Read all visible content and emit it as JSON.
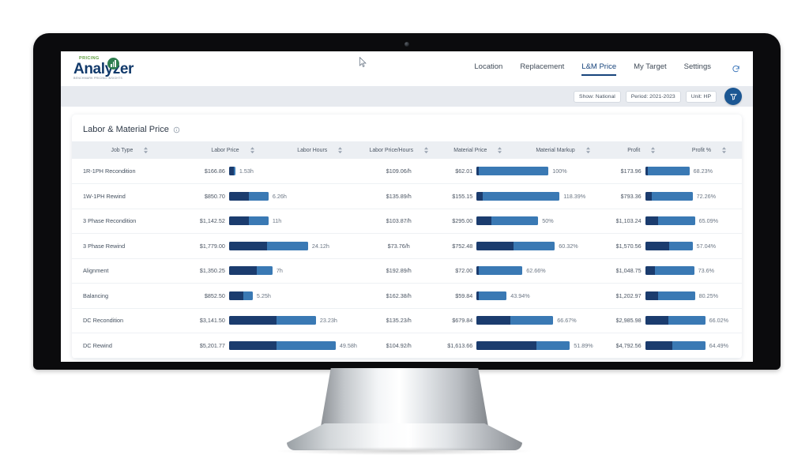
{
  "brand": {
    "kicker": "PRICING",
    "name": "Analyzer",
    "tagline": "BENCHMARK PRICING INSIGHTS",
    "chart_badge_icon": "bar-chart-icon"
  },
  "nav": {
    "items": [
      {
        "label": "Location",
        "active": false
      },
      {
        "label": "Replacement",
        "active": false
      },
      {
        "label": "L&M Price",
        "active": true
      },
      {
        "label": "My Target",
        "active": false
      },
      {
        "label": "Settings",
        "active": false
      }
    ],
    "refresh_icon": "refresh-icon"
  },
  "filters": {
    "chips": [
      {
        "label": "Show: National"
      },
      {
        "label": "Period: 2021-2023"
      },
      {
        "label": "Unit: HP"
      }
    ],
    "funnel_icon": "funnel-icon",
    "funnel_color": "#1c5793"
  },
  "card": {
    "title": "Labor & Material Price",
    "info_icon": "info-circle-icon"
  },
  "colors": {
    "bar_dark": "#1b3c6e",
    "bar_light": "#3a79b4",
    "accent": "#17447c",
    "header_bg": "#eceff3",
    "filter_bar_bg": "#e7eaef"
  },
  "table": {
    "columns": [
      {
        "label": "Job Type",
        "sortable": true
      },
      {
        "label": "Labor Price",
        "sortable": true
      },
      {
        "label": "Labor Hours",
        "sortable": true
      },
      {
        "label": "Labor Price/Hours",
        "sortable": true
      },
      {
        "label": "Material Price",
        "sortable": true
      },
      {
        "label": "Material Markup",
        "sortable": true
      },
      {
        "label": "Profit",
        "sortable": true
      },
      {
        "label": "Profit %",
        "sortable": true
      }
    ],
    "rows": [
      {
        "job_type": "1R-1PH Recondition",
        "labor_price": "$166.86",
        "labor_hours": "1.53h",
        "labor_price_per_hour": "$109.06/h",
        "material_price": "$62.01",
        "material_markup": "100%",
        "profit": "$173.96",
        "profit_pct": "68.23%"
      },
      {
        "job_type": "1W-1PH Rewind",
        "labor_price": "$850.70",
        "labor_hours": "6.26h",
        "labor_price_per_hour": "$135.89/h",
        "material_price": "$155.15",
        "material_markup": "118.39%",
        "profit": "$793.36",
        "profit_pct": "72.26%"
      },
      {
        "job_type": "3 Phase Recondition",
        "labor_price": "$1,142.52",
        "labor_hours": "11h",
        "labor_price_per_hour": "$103.87/h",
        "material_price": "$295.00",
        "material_markup": "50%",
        "profit": "$1,103.24",
        "profit_pct": "65.09%"
      },
      {
        "job_type": "3 Phase Rewind",
        "labor_price": "$1,779.00",
        "labor_hours": "24.12h",
        "labor_price_per_hour": "$73.76/h",
        "material_price": "$752.48",
        "material_markup": "60.32%",
        "profit": "$1,570.56",
        "profit_pct": "57.04%"
      },
      {
        "job_type": "Alignment",
        "labor_price": "$1,350.25",
        "labor_hours": "7h",
        "labor_price_per_hour": "$192.89/h",
        "material_price": "$72.00",
        "material_markup": "62.66%",
        "profit": "$1,048.75",
        "profit_pct": "73.6%"
      },
      {
        "job_type": "Balancing",
        "labor_price": "$852.50",
        "labor_hours": "5.25h",
        "labor_price_per_hour": "$162.38/h",
        "material_price": "$59.84",
        "material_markup": "43.94%",
        "profit": "$1,202.97",
        "profit_pct": "80.25%"
      },
      {
        "job_type": "DC Recondition",
        "labor_price": "$3,141.50",
        "labor_hours": "23.23h",
        "labor_price_per_hour": "$135.23/h",
        "material_price": "$679.84",
        "material_markup": "66.67%",
        "profit": "$2,985.98",
        "profit_pct": "66.02%"
      },
      {
        "job_type": "DC Rewind",
        "labor_price": "$5,201.77",
        "labor_hours": "49.58h",
        "labor_price_per_hour": "$104.92/h",
        "material_price": "$1,613.66",
        "material_markup": "51.89%",
        "profit": "$4,792.56",
        "profit_pct": "64.49%"
      }
    ]
  },
  "chart_data": {
    "type": "bar",
    "title": "Labor & Material Price",
    "categories": [
      "1R-1PH Recondition",
      "1W-1PH Rewind",
      "3 Phase Recondition",
      "3 Phase Rewind",
      "Alignment",
      "Balancing",
      "DC Recondition",
      "DC Rewind"
    ],
    "series": [
      {
        "name": "Labor Price",
        "values": [
          166.86,
          850.7,
          1142.52,
          1779.0,
          1350.25,
          852.5,
          3141.5,
          5201.77
        ],
        "unit": "USD"
      },
      {
        "name": "Labor Hours",
        "values": [
          1.53,
          6.26,
          11,
          24.12,
          7,
          5.25,
          23.23,
          49.58
        ],
        "unit": "h"
      },
      {
        "name": "Labor Price/Hours",
        "values": [
          109.06,
          135.89,
          103.87,
          73.76,
          192.89,
          162.38,
          135.23,
          104.92
        ],
        "unit": "USD/h"
      },
      {
        "name": "Material Price",
        "values": [
          62.01,
          155.15,
          295.0,
          752.48,
          72.0,
          59.84,
          679.84,
          1613.66
        ],
        "unit": "USD"
      },
      {
        "name": "Material Markup",
        "values": [
          100,
          118.39,
          50,
          60.32,
          62.66,
          43.94,
          66.67,
          51.89
        ],
        "unit": "%"
      },
      {
        "name": "Profit",
        "values": [
          173.96,
          793.36,
          1103.24,
          1570.56,
          1048.75,
          1202.97,
          2985.98,
          4792.56
        ],
        "unit": "USD"
      },
      {
        "name": "Profit %",
        "values": [
          68.23,
          72.26,
          65.09,
          57.04,
          73.6,
          80.25,
          66.02,
          64.49
        ],
        "unit": "%"
      }
    ],
    "bar_segments": {
      "labor_hours": [
        {
          "dark": 6,
          "light": 2
        },
        {
          "dark": 25,
          "light": 25
        },
        {
          "dark": 25,
          "light": 25
        },
        {
          "dark": 48,
          "light": 52
        },
        {
          "dark": 35,
          "light": 20
        },
        {
          "dark": 18,
          "light": 12
        },
        {
          "dark": 60,
          "light": 50
        },
        {
          "dark": 60,
          "light": 75
        }
      ],
      "material_markup": [
        {
          "dark": 3,
          "light": 88
        },
        {
          "dark": 8,
          "light": 97
        },
        {
          "dark": 19,
          "light": 59
        },
        {
          "dark": 47,
          "light": 52
        },
        {
          "dark": 3,
          "light": 55
        },
        {
          "dark": 3,
          "light": 35
        },
        {
          "dark": 43,
          "light": 54
        },
        {
          "dark": 76,
          "light": 42
        }
      ],
      "profit": [
        {
          "dark": 3,
          "light": 53
        },
        {
          "dark": 8,
          "light": 52
        },
        {
          "dark": 16,
          "light": 47
        },
        {
          "dark": 30,
          "light": 30
        },
        {
          "dark": 12,
          "light": 50
        },
        {
          "dark": 16,
          "light": 47
        },
        {
          "dark": 29,
          "light": 47
        },
        {
          "dark": 34,
          "light": 42
        }
      ]
    },
    "grid": false,
    "legend": "none",
    "xlabel": "",
    "ylabel": ""
  }
}
